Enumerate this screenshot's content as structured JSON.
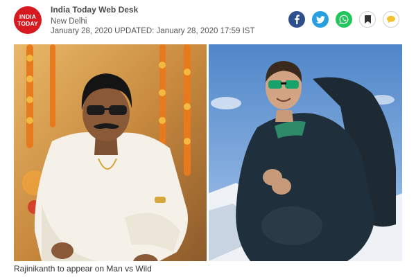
{
  "header": {
    "logo_line1": "INDIA",
    "logo_line2": "TODAY",
    "author": "India Today Web Desk",
    "location": "New Delhi",
    "date_line": "January 28, 2020 UPDATED: January 28, 2020 17:59 IST"
  },
  "share": {
    "icons": [
      "facebook-icon",
      "twitter-icon",
      "whatsapp-icon",
      "bookmark-icon",
      "comment-icon"
    ],
    "colors": {
      "facebook": "#2d4f8c",
      "twitter": "#2a9fe0",
      "whatsapp": "#22c55e",
      "brand": "#d71920"
    }
  },
  "article": {
    "caption": "Rajinikanth to appear on Man vs Wild"
  }
}
